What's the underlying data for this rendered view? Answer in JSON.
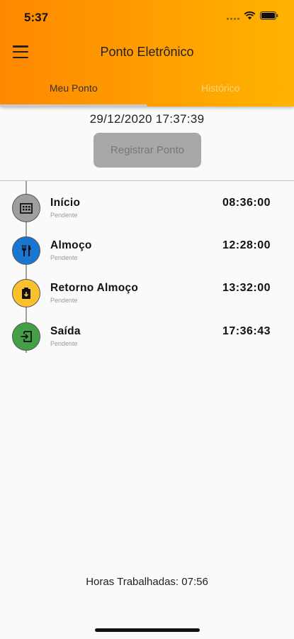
{
  "status_bar": {
    "time": "5:37"
  },
  "app_bar": {
    "title": "Ponto Eletrônico"
  },
  "tabs": [
    {
      "label": "Meu Ponto",
      "active": true
    },
    {
      "label": "Histórico",
      "active": false
    }
  ],
  "current_datetime": "29/12/2020 17:37:39",
  "register_button": {
    "label": "Registrar Ponto",
    "enabled": false
  },
  "entries": [
    {
      "label": "Início",
      "status": "Pendente",
      "time": "08:36:00",
      "icon": "building-icon",
      "color": "#9e9e9e"
    },
    {
      "label": "Almoço",
      "status": "Pendente",
      "time": "12:28:00",
      "icon": "restaurant-icon",
      "color": "#1976d2"
    },
    {
      "label": "Retorno Almoço",
      "status": "Pendente",
      "time": "13:32:00",
      "icon": "clipboard-icon",
      "color": "#fbc02d"
    },
    {
      "label": "Saída",
      "status": "Pendente",
      "time": "17:36:43",
      "icon": "exit-icon",
      "color": "#43a047"
    }
  ],
  "footer": {
    "worked_hours": "Horas Trabalhadas: 07:56"
  }
}
